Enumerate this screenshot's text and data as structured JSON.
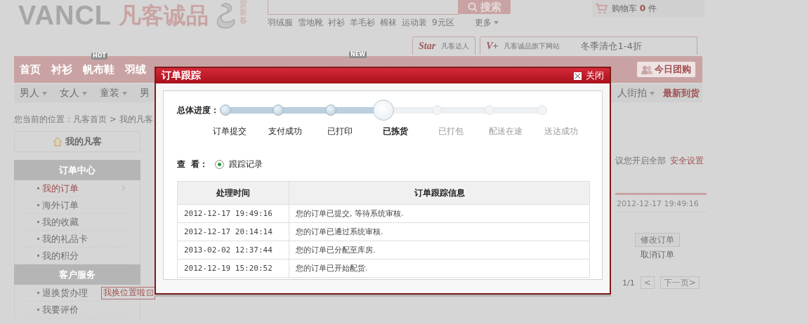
{
  "header": {
    "logo_text": "VANCL",
    "brand_name": "凡客诚品",
    "festival_text": "贺新春",
    "search": {
      "button": "搜索"
    },
    "hot_keywords": [
      "羽绒服",
      "雪地靴",
      "衬衫",
      "羊毛衫",
      "棉袜",
      "运动装",
      "9元区"
    ],
    "more_link": "更多",
    "cart": {
      "label": "购物车",
      "count": "0",
      "unit": "件"
    }
  },
  "promo_bar": {
    "star_logo": "Star",
    "star_label": "凡客达人",
    "vplus_logo": "V+",
    "vplus_label": "凡客诚品旗下网站",
    "sale_text": "冬季清仓1-4折"
  },
  "main_nav": {
    "items": [
      {
        "label": "首页"
      },
      {
        "label": "衬衫"
      },
      {
        "label": "帆布鞋",
        "badge": "HOT"
      },
      {
        "label": "羽绒"
      }
    ],
    "hidden_item_badge": "NEW",
    "group_buy_button": "今日团购"
  },
  "sub_nav": {
    "left_items": [
      {
        "label": "男人",
        "dropdown": true
      },
      {
        "label": "女人",
        "dropdown": true
      },
      {
        "label": "童装",
        "dropdown": true
      },
      {
        "label": "男",
        "dropdown": false
      }
    ],
    "right_items": [
      {
        "label": "人街拍",
        "dropdown": true,
        "highlighted": false
      },
      {
        "label": "最新到货",
        "dropdown": false,
        "highlighted": true
      }
    ]
  },
  "breadcrumb": "您当前的位置：凡客首页 > 我的凡客",
  "sidebar": {
    "home_link": "我的凡客",
    "sections": [
      {
        "title": "订单中心",
        "items": [
          {
            "label": "我的订单",
            "selected": true
          },
          {
            "label": "海外订单",
            "selected": false
          },
          {
            "label": "我的收藏",
            "selected": false
          },
          {
            "label": "我的礼品卡",
            "selected": false
          },
          {
            "label": "我的积分",
            "selected": false
          }
        ]
      },
      {
        "title": "客户服务",
        "items": [
          {
            "label": "退换货办理",
            "selected": false,
            "tag": "我换位置啦"
          },
          {
            "label": "我要评价",
            "selected": false
          }
        ]
      }
    ]
  },
  "account_panel": {
    "security_tip": "议您开启全部",
    "security_link": "安全设置",
    "order_time": "2012-12-17 19:49:16",
    "modify_button": "修改订单",
    "cancel_link": "取消订单",
    "page_info": "1/1",
    "prev_button": "<",
    "next_button": "下一页>"
  },
  "dialog": {
    "title": "订单跟踪",
    "close_label": "关闭",
    "progress_label": "总体进度：",
    "steps": [
      {
        "label": "订单提交",
        "kind": "done"
      },
      {
        "label": "支付成功",
        "kind": "done"
      },
      {
        "label": "已打印",
        "kind": "done"
      },
      {
        "label": "已拣货",
        "kind": "current"
      },
      {
        "label": "已打包",
        "kind": "pending"
      },
      {
        "label": "配送在途",
        "kind": "pending"
      },
      {
        "label": "送达成功",
        "kind": "pending"
      }
    ],
    "view_label": "查  看：",
    "view_options": [
      {
        "label": "跟踪记录",
        "selected": true
      }
    ],
    "table": {
      "columns": [
        "处理时间",
        "订单跟踪信息"
      ],
      "rows": [
        [
          "2012-12-17 19:49:16",
          "您的订单已提交, 等待系统审核."
        ],
        [
          "2012-12-17 20:14:14",
          "您的订单已通过系统审核."
        ],
        [
          "2013-02-02 12:37:44",
          "您的订单已分配至库房."
        ],
        [
          "2012-12-19 15:20:52",
          "您的订单已开始配货."
        ]
      ]
    }
  }
}
